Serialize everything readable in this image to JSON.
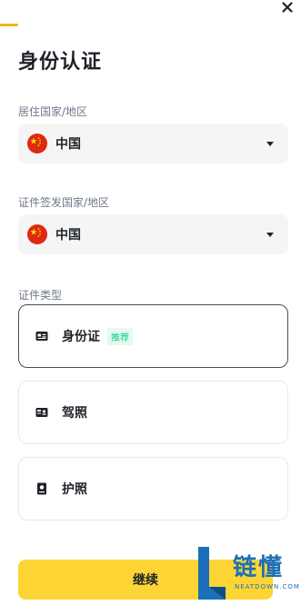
{
  "header": {
    "close_icon": "close-icon",
    "progress_fraction": 0.06,
    "accent_color": "#f0b90b"
  },
  "page": {
    "title": "身份认证"
  },
  "residence": {
    "label": "居住国家/地区",
    "value": "中国",
    "flag_icon": "china-flag-icon"
  },
  "issuing": {
    "label": "证件签发国家/地区",
    "value": "中国",
    "flag_icon": "china-flag-icon"
  },
  "document_type": {
    "label": "证件类型",
    "options": [
      {
        "label": "身份证",
        "badge": "推荐",
        "icon": "id-card-icon",
        "selected": true
      },
      {
        "label": "驾照",
        "icon": "driver-license-icon",
        "selected": false
      },
      {
        "label": "护照",
        "icon": "passport-icon",
        "selected": false
      }
    ]
  },
  "footer": {
    "continue_label": "继续",
    "button_color": "#fcd535"
  },
  "watermark": {
    "text": "链懂",
    "subtext": "NEATDOWN.COM"
  }
}
